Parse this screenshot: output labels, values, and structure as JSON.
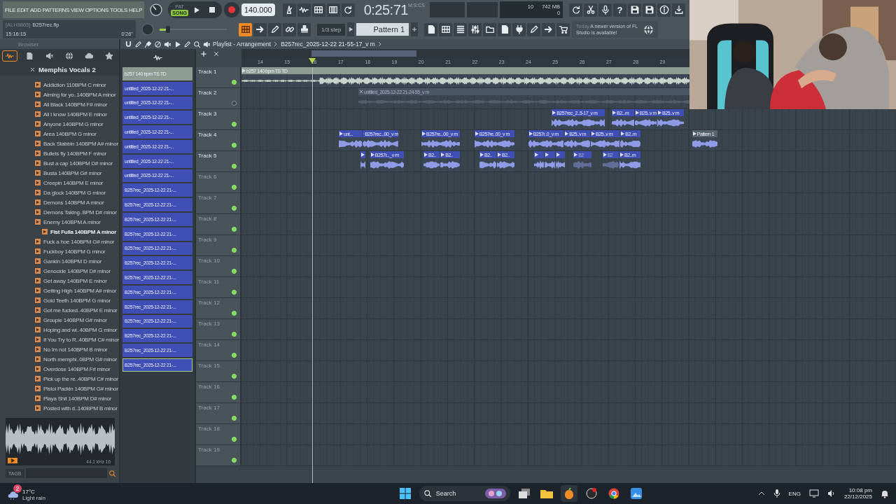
{
  "menu": [
    "FILE",
    "EDIT",
    "ADD",
    "PATTERNS",
    "VIEW",
    "OPTIONS",
    "TOOLS",
    "HELP"
  ],
  "transport": {
    "modes": [
      {
        "label": "PAT",
        "selected": false
      },
      {
        "label": "SONG",
        "selected": true
      }
    ],
    "tempo": "140.000"
  },
  "time": {
    "value": "0:25:71",
    "unit": "M:S:CS"
  },
  "monitor": {
    "cpu": "10",
    "memory": "742 MB",
    "polyphony": "0"
  },
  "help": "?",
  "project": {
    "id": "[ALH9865]",
    "file": "B257rec.flp",
    "clock": "15:16:15",
    "duration": "0'26\""
  },
  "master_pitch": {
    "level": 0.12
  },
  "snap": "1/3 step",
  "pattern": "Pattern 1",
  "news": {
    "when": "Today",
    "text": "A newer version of FL Studio is available!"
  },
  "browser": {
    "title": "Browser",
    "tabs": [
      {
        "selected": true
      },
      {
        "selected": false
      },
      {
        "selected": false
      },
      {
        "selected": false
      },
      {
        "selected": false
      },
      {
        "selected": false
      }
    ],
    "folder": "Memphis Vocals 2",
    "items": [
      {
        "label": "Addiction 110BPM C minor",
        "selected": false
      },
      {
        "label": "Aiming for yo..140BPM A minor",
        "selected": false
      },
      {
        "label": "All Black 140BPM F# minor",
        "selected": false
      },
      {
        "label": "All I know 140BPM E minor",
        "selected": false
      },
      {
        "label": "Anyone 140BPM G minor",
        "selected": false
      },
      {
        "label": "Area 140BPM G minor",
        "selected": false
      },
      {
        "label": "Back Stabbin 140BPM A# minor",
        "selected": false
      },
      {
        "label": "Bullets fly 140BPM F minor",
        "selected": false
      },
      {
        "label": "Bust a cap 140BPM D# minor",
        "selected": false
      },
      {
        "label": "Busta 140BPM G# minor",
        "selected": false
      },
      {
        "label": "Creepin 140BPM E minor",
        "selected": false
      },
      {
        "label": "Da glock 140BPM G minor",
        "selected": false
      },
      {
        "label": "Demons 140BPM A minor",
        "selected": false
      },
      {
        "label": "Demons Taking..BPM D# minor",
        "selected": false
      },
      {
        "label": "Enemy 140BPM A minor",
        "selected": false
      },
      {
        "label": "Fist Fulla 140BPM A minor",
        "selected": true
      },
      {
        "label": "Fuck a hoe 140BPM G# minor",
        "selected": false
      },
      {
        "label": "Fuckboy 140BPM G minor",
        "selected": false
      },
      {
        "label": "Gankin 140BPM D minor",
        "selected": false
      },
      {
        "label": "Genocide 140BPM D# minor",
        "selected": false
      },
      {
        "label": "Get away 140BPM E minor",
        "selected": false
      },
      {
        "label": "Getting High 140BPM A# minor",
        "selected": false
      },
      {
        "label": "Gold Teeth 140BPM G minor",
        "selected": false
      },
      {
        "label": "Got me fucked..40BPM E minor",
        "selected": false
      },
      {
        "label": "Groupie 140BPM G# minor",
        "selected": false
      },
      {
        "label": "Hoping and wi..40BPM G minor",
        "selected": false
      },
      {
        "label": "If You Try to R..40BPM C# minor",
        "selected": false
      },
      {
        "label": "No Im not 140BPM B minor",
        "selected": false
      },
      {
        "label": "North memphi..0BPM G# minor",
        "selected": false
      },
      {
        "label": "Overdose 140BPM F# minor",
        "selected": false
      },
      {
        "label": "Pick up the re..40BPM C# minor",
        "selected": false
      },
      {
        "label": "Pistol Packin 140BPM G# minor",
        "selected": false
      },
      {
        "label": "Playa Shit 140BPM D# minor",
        "selected": false
      },
      {
        "label": "Posted with d..140BPM B minor",
        "selected": false
      }
    ],
    "preview": {
      "format": "44.1 kHz 16"
    },
    "tags": "TAGS"
  },
  "clips": [
    {
      "label": "b257 140 bpm TS TD",
      "color": "#8d9c92",
      "selected": false
    },
    {
      "label": "untitled_2025-12-22 21-...",
      "color": "#3f4fb5",
      "selected": false
    },
    {
      "label": "untitled_2025-12-22 21-...",
      "color": "#3f4fb5",
      "selected": false
    },
    {
      "label": "untitled_2025-12-22 21-...",
      "color": "#3f4fb5",
      "selected": false
    },
    {
      "label": "untitled_2025-12-22 21-...",
      "color": "#3f4fb5",
      "selected": false
    },
    {
      "label": "untitled_2025-12-22 21-...",
      "color": "#3f4fb5",
      "selected": false
    },
    {
      "label": "untitled_2025-12-22 21-...",
      "color": "#3f4fb5",
      "selected": false
    },
    {
      "label": "untitled_2025-12-22 21-...",
      "color": "#3f4fb5",
      "selected": false
    },
    {
      "label": "B257rec_2025-12-22 21-...",
      "color": "#3f4fb5",
      "selected": false
    },
    {
      "label": "B257rec_2025-12-22 21-...",
      "color": "#3f4fb5",
      "selected": false
    },
    {
      "label": "B257rec_2025-12-22 21-...",
      "color": "#3f4fb5",
      "selected": false
    },
    {
      "label": "B257rec_2025-12-22 21-...",
      "color": "#3f4fb5",
      "selected": false
    },
    {
      "label": "B257rec_2025-12-22 21-...",
      "color": "#3f4fb5",
      "selected": false
    },
    {
      "label": "B257rec_2025-12-22 21-...",
      "color": "#3f4fb5",
      "selected": false
    },
    {
      "label": "B257rec_2025-12-22 21-...",
      "color": "#3f4fb5",
      "selected": false
    },
    {
      "label": "B257rec_2025-12-22 21-...",
      "color": "#3f4fb5",
      "selected": false
    },
    {
      "label": "B257rec_2025-12-22 21-...",
      "color": "#3f4fb5",
      "selected": false
    },
    {
      "label": "B257rec_2025-12-22 21-...",
      "color": "#3f4fb5",
      "selected": false
    },
    {
      "label": "B257rec_2025-12-22 21-...",
      "color": "#3f4fb5",
      "selected": false
    },
    {
      "label": "B257rec_2025-12-22 21-...",
      "color": "#3f4fb5",
      "selected": false
    },
    {
      "label": "B257rec_2025-12-22 21-...",
      "color": "#3f4fb5",
      "selected": true
    }
  ],
  "playlist": {
    "title": "Playlist - Arrangement",
    "clip": "B257rec_2025-12-22 21-55-17_v m",
    "bars": [
      "14",
      "15",
      "16",
      "17",
      "18",
      "19",
      "20",
      "21",
      "22",
      "23",
      "24",
      "25",
      "26",
      "27",
      "28",
      "29"
    ],
    "tracks": [
      {
        "name": "Track 1",
        "muted": false,
        "clips": [
          {
            "label": "b257 140 bpm TS TD",
            "color": "#8d9c92",
            "muted": false
          }
        ]
      },
      {
        "name": "Track 2",
        "muted": true,
        "clips": [
          {
            "label": "untitled_2025-12-22 21-24-55_v m",
            "color": "#4a5663",
            "muted": true
          }
        ]
      },
      {
        "name": "Track 3",
        "muted": false,
        "clips": [
          {
            "label": "B257rec_2..5-17_v m",
            "color": "#3f4fb5",
            "muted": false
          },
          {
            "label": "B2...m",
            "color": "#3f4fb5",
            "muted": false
          },
          {
            "label": "B25..v m",
            "color": "#3f4fb5",
            "muted": false
          },
          {
            "label": "B25..v m",
            "color": "#3f4fb5",
            "muted": false
          }
        ]
      },
      {
        "name": "Track 4",
        "muted": false,
        "clips": [
          {
            "label": "unt...",
            "color": "#3f4fb5",
            "muted": false
          },
          {
            "label": "B257rec...00_v m",
            "color": "#3f4fb5",
            "muted": false
          },
          {
            "label": "B257re...00_v m",
            "color": "#3f4fb5",
            "muted": false
          },
          {
            "label": "B257re..00_v m",
            "color": "#3f4fb5",
            "muted": false
          },
          {
            "label": "B257r..0_v m",
            "color": "#3f4fb5",
            "muted": false
          },
          {
            "label": "B25..v m",
            "color": "#3f4fb5",
            "muted": false
          },
          {
            "label": "B25..v m",
            "color": "#3f4fb5",
            "muted": false
          },
          {
            "label": "B2..m",
            "color": "#3f4fb5",
            "muted": false
          },
          {
            "label": "Pattern 1",
            "color": "#56626c",
            "muted": false
          }
        ]
      },
      {
        "name": "Track 5",
        "muted": false,
        "clips": [
          {
            "color": "#3f4fb5",
            "muted": false
          },
          {
            "label": "B257r..._v m",
            "color": "#3f4fb5",
            "muted": false
          },
          {
            "label": "B2..",
            "color": "#3f4fb5",
            "muted": false
          },
          {
            "label": "B2..",
            "color": "#3f4fb5",
            "muted": false
          },
          {
            "label": "B2..",
            "color": "#3f4fb5",
            "muted": false
          },
          {
            "label": "B2..",
            "color": "#3f4fb5",
            "muted": false
          },
          {
            "color": "#3f4fb5",
            "muted": false
          },
          {
            "color": "#3f4fb5",
            "muted": false
          },
          {
            "color": "#3f4fb5",
            "muted": false
          },
          {
            "label": "B2",
            "color": "#3f4fb5",
            "muted": true
          },
          {
            "label": "B2",
            "color": "#3f4fb5",
            "muted": true
          },
          {
            "label": "B2..m",
            "color": "#3f4fb5",
            "muted": false
          }
        ]
      },
      {
        "name": "Track 6",
        "muted": false
      },
      {
        "name": "Track 7",
        "muted": false
      },
      {
        "name": "Track 8",
        "muted": false
      },
      {
        "name": "Track 9",
        "muted": false
      },
      {
        "name": "Track 10",
        "muted": false
      },
      {
        "name": "Track 11",
        "muted": false
      },
      {
        "name": "Track 12",
        "muted": false
      },
      {
        "name": "Track 13",
        "muted": false
      },
      {
        "name": "Track 14",
        "muted": false
      },
      {
        "name": "Track 15",
        "muted": false
      },
      {
        "name": "Track 16",
        "muted": false
      },
      {
        "name": "Track 17",
        "muted": false
      },
      {
        "name": "Track 18",
        "muted": false
      },
      {
        "name": "Track 19",
        "muted": false
      }
    ]
  },
  "webcam": {
    "kind": "picture"
  },
  "taskbar": {
    "weather": {
      "temp": "17°C",
      "text": "Light rain",
      "badge": "2"
    },
    "search": "Search",
    "language": "ENG",
    "time": "10:08 pm",
    "date": "22/12/2025"
  }
}
